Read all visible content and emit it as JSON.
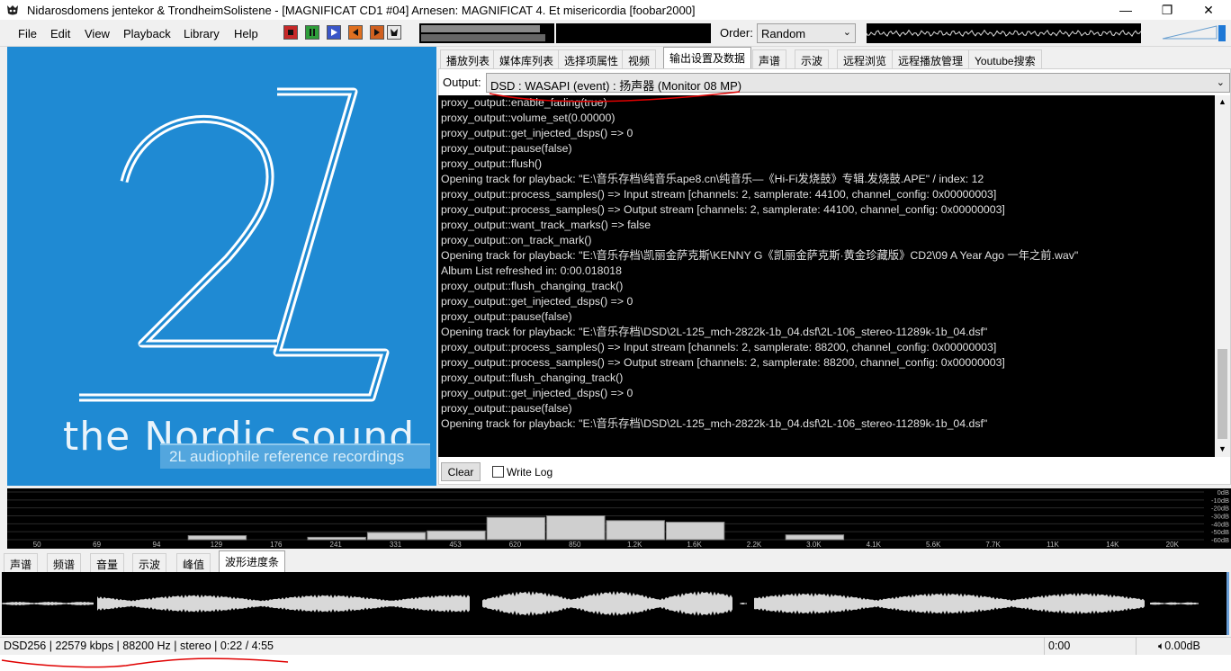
{
  "window": {
    "title": "Nidarosdomens jentekor & TrondheimSolistene - [MAGNIFICAT CD1 #04] Arnesen: MAGNIFICAT 4. Et misericordia  [foobar2000]",
    "minimize": "—",
    "maximize": "❐",
    "close": "✕"
  },
  "menu": [
    "File",
    "Edit",
    "View",
    "Playback",
    "Library",
    "Help"
  ],
  "order": {
    "label": "Order:",
    "value": "Random"
  },
  "album_art": {
    "logo": "2L",
    "tagline": "the Nordic sound",
    "banner": "2L audiophile reference recordings"
  },
  "tabs": [
    "播放列表",
    "媒体库列表",
    "选择项属性",
    "视频",
    "输出设置及数据",
    "声谱",
    "示波",
    "远程浏览",
    "远程播放管理",
    "Youtube搜索"
  ],
  "output": {
    "label": "Output:",
    "value": "DSD : WASAPI (event) : 扬声器 (Monitor 08 MP)"
  },
  "console_lines": [
    "proxy_output::enable_fading(true)",
    "proxy_output::volume_set(0.00000)",
    "proxy_output::get_injected_dsps() => 0",
    "proxy_output::pause(false)",
    "proxy_output::flush()",
    "Opening track for playback: \"E:\\音乐存档\\纯音乐ape8.cn\\纯音乐—《Hi-Fi发烧鼓》专辑.发烧鼓.APE\" / index: 12",
    "proxy_output::process_samples() => Input stream [channels: 2, samplerate: 44100, channel_config: 0x00000003]",
    "proxy_output::process_samples() => Output stream [channels: 2, samplerate: 44100, channel_config: 0x00000003]",
    "proxy_output::want_track_marks() => false",
    "proxy_output::on_track_mark()",
    "Opening track for playback: \"E:\\音乐存档\\凯丽金萨克斯\\KENNY G《凯丽金萨克斯·黄金珍藏版》CD2\\09 A Year Ago 一年之前.wav\"",
    "Album List refreshed in: 0:00.018018",
    "proxy_output::flush_changing_track()",
    "proxy_output::get_injected_dsps() => 0",
    "proxy_output::pause(false)",
    "Opening track for playback: \"E:\\音乐存档\\DSD\\2L-125_mch-2822k-1b_04.dsf\\2L-106_stereo-11289k-1b_04.dsf\"",
    "proxy_output::process_samples() => Input stream [channels: 2, samplerate: 88200, channel_config: 0x00000003]",
    "proxy_output::process_samples() => Output stream [channels: 2, samplerate: 88200, channel_config: 0x00000003]",
    "proxy_output::flush_changing_track()",
    "proxy_output::get_injected_dsps() => 0",
    "proxy_output::pause(false)",
    "Opening track for playback: \"E:\\音乐存档\\DSD\\2L-125_mch-2822k-1b_04.dsf\\2L-106_stereo-11289k-1b_04.dsf\""
  ],
  "console_controls": {
    "clear": "Clear",
    "write_log": "Write Log"
  },
  "spectrum": {
    "freq_labels": [
      "50",
      "69",
      "94",
      "129",
      "176",
      "241",
      "331",
      "453",
      "620",
      "850",
      "1.2K",
      "1.6K",
      "2.2K",
      "3.0K",
      "4.1K",
      "5.6K",
      "7.7K",
      "11K",
      "14K",
      "20K"
    ],
    "db_labels": [
      "0dB",
      "-10dB",
      "-20dB",
      "-30dB",
      "-40dB",
      "-50dB",
      "-60dB"
    ],
    "levels_db": [
      -60,
      -60,
      -60,
      -55,
      -60,
      -57,
      -51,
      -49,
      -32,
      -30,
      -36,
      -38,
      -60,
      -54,
      -60,
      -60,
      -60,
      -60,
      -60,
      -60
    ]
  },
  "bottom_tabs": [
    "声谱",
    "频谱",
    "音量",
    "示波",
    "峰值",
    "波形进度条"
  ],
  "status": {
    "info": "DSD256 | 22579 kbps | 88200 Hz | stereo | 0:22 / 4:55",
    "time": "0:00",
    "volume": "0.00dB"
  },
  "colors": {
    "album_bg": "#1f8ad3",
    "annotation": "#e00000"
  }
}
